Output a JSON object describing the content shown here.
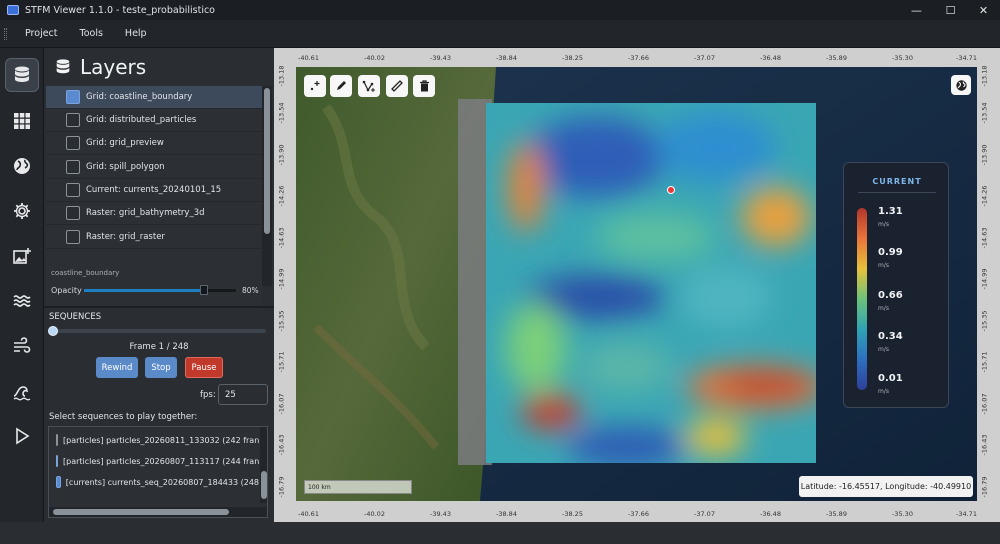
{
  "window": {
    "title": "STFM Viewer 1.1.0 - teste_probabilistico",
    "minimize": "—",
    "maximize": "☐",
    "close": "✕"
  },
  "menu": [
    "Project",
    "Tools",
    "Help"
  ],
  "sidebar": {
    "items": [
      "database-icon",
      "grid-icon",
      "globe-icon",
      "gear-icon",
      "add-image-icon",
      "waves-icon",
      "wind-icon",
      "wave-icon",
      "play-icon"
    ]
  },
  "layers": {
    "title": "Layers",
    "items": [
      {
        "label": "Grid: coastline_boundary",
        "checked": true,
        "selected": true
      },
      {
        "label": "Grid: distributed_particles",
        "checked": false
      },
      {
        "label": "Grid: grid_preview",
        "checked": false
      },
      {
        "label": "Grid: spill_polygon",
        "checked": false
      },
      {
        "label": "Current: currents_20240101_15",
        "checked": false
      },
      {
        "label": "Raster: grid_bathymetry_3d",
        "checked": false
      },
      {
        "label": "Raster: grid_raster",
        "checked": false
      }
    ],
    "selected_name": "coastline_boundary",
    "opacity_label": "Opacity",
    "opacity_value": "80%",
    "opacity_fraction": 0.8
  },
  "sequences": {
    "title": "SEQUENCES",
    "frame_label": "Frame 1 / 248",
    "rewind": "Rewind",
    "stop": "Stop",
    "pause": "Pause",
    "fps_label": "fps:",
    "fps_value": "25",
    "select_label": "Select sequences to play together:",
    "items": [
      {
        "label": "[particles]  particles_20260811_133032  (242 fran",
        "checked": false
      },
      {
        "label": "[particles]  particles_20260807_113117  (244 fran",
        "checked": true
      },
      {
        "label": "[currents]  currents_seq_20260807_184433  (248",
        "checked": true
      }
    ]
  },
  "map": {
    "lon_ticks": [
      "-40.61",
      "-40.02",
      "-39.43",
      "-38.84",
      "-38.25",
      "-37.66",
      "-37.07",
      "-36.48",
      "-35.89",
      "-35.30",
      "-34.71"
    ],
    "lat_ticks": [
      "-13.18",
      "-13.54",
      "-13.90",
      "-14.26",
      "-14.63",
      "-14.99",
      "-15.35",
      "-15.71",
      "-16.07",
      "-16.43",
      "-16.79"
    ],
    "scale_label": "100 km",
    "coords_label": "Latitude: -16.45517, Longitude: -40.49910",
    "tools": [
      "add-point-icon",
      "pencil-icon",
      "polyline-icon",
      "ruler-icon",
      "trash-icon"
    ],
    "globe_button": "globe-icon"
  },
  "legend": {
    "title": "CURRENT",
    "values": [
      "1.31",
      "0.99",
      "0.66",
      "0.34",
      "0.01"
    ],
    "unit": "m/s",
    "colors": [
      "#b2362c",
      "#e8743b",
      "#e9c13a",
      "#6cc27a",
      "#2fa3b3",
      "#2e6fc0",
      "#2e3f9a"
    ]
  }
}
